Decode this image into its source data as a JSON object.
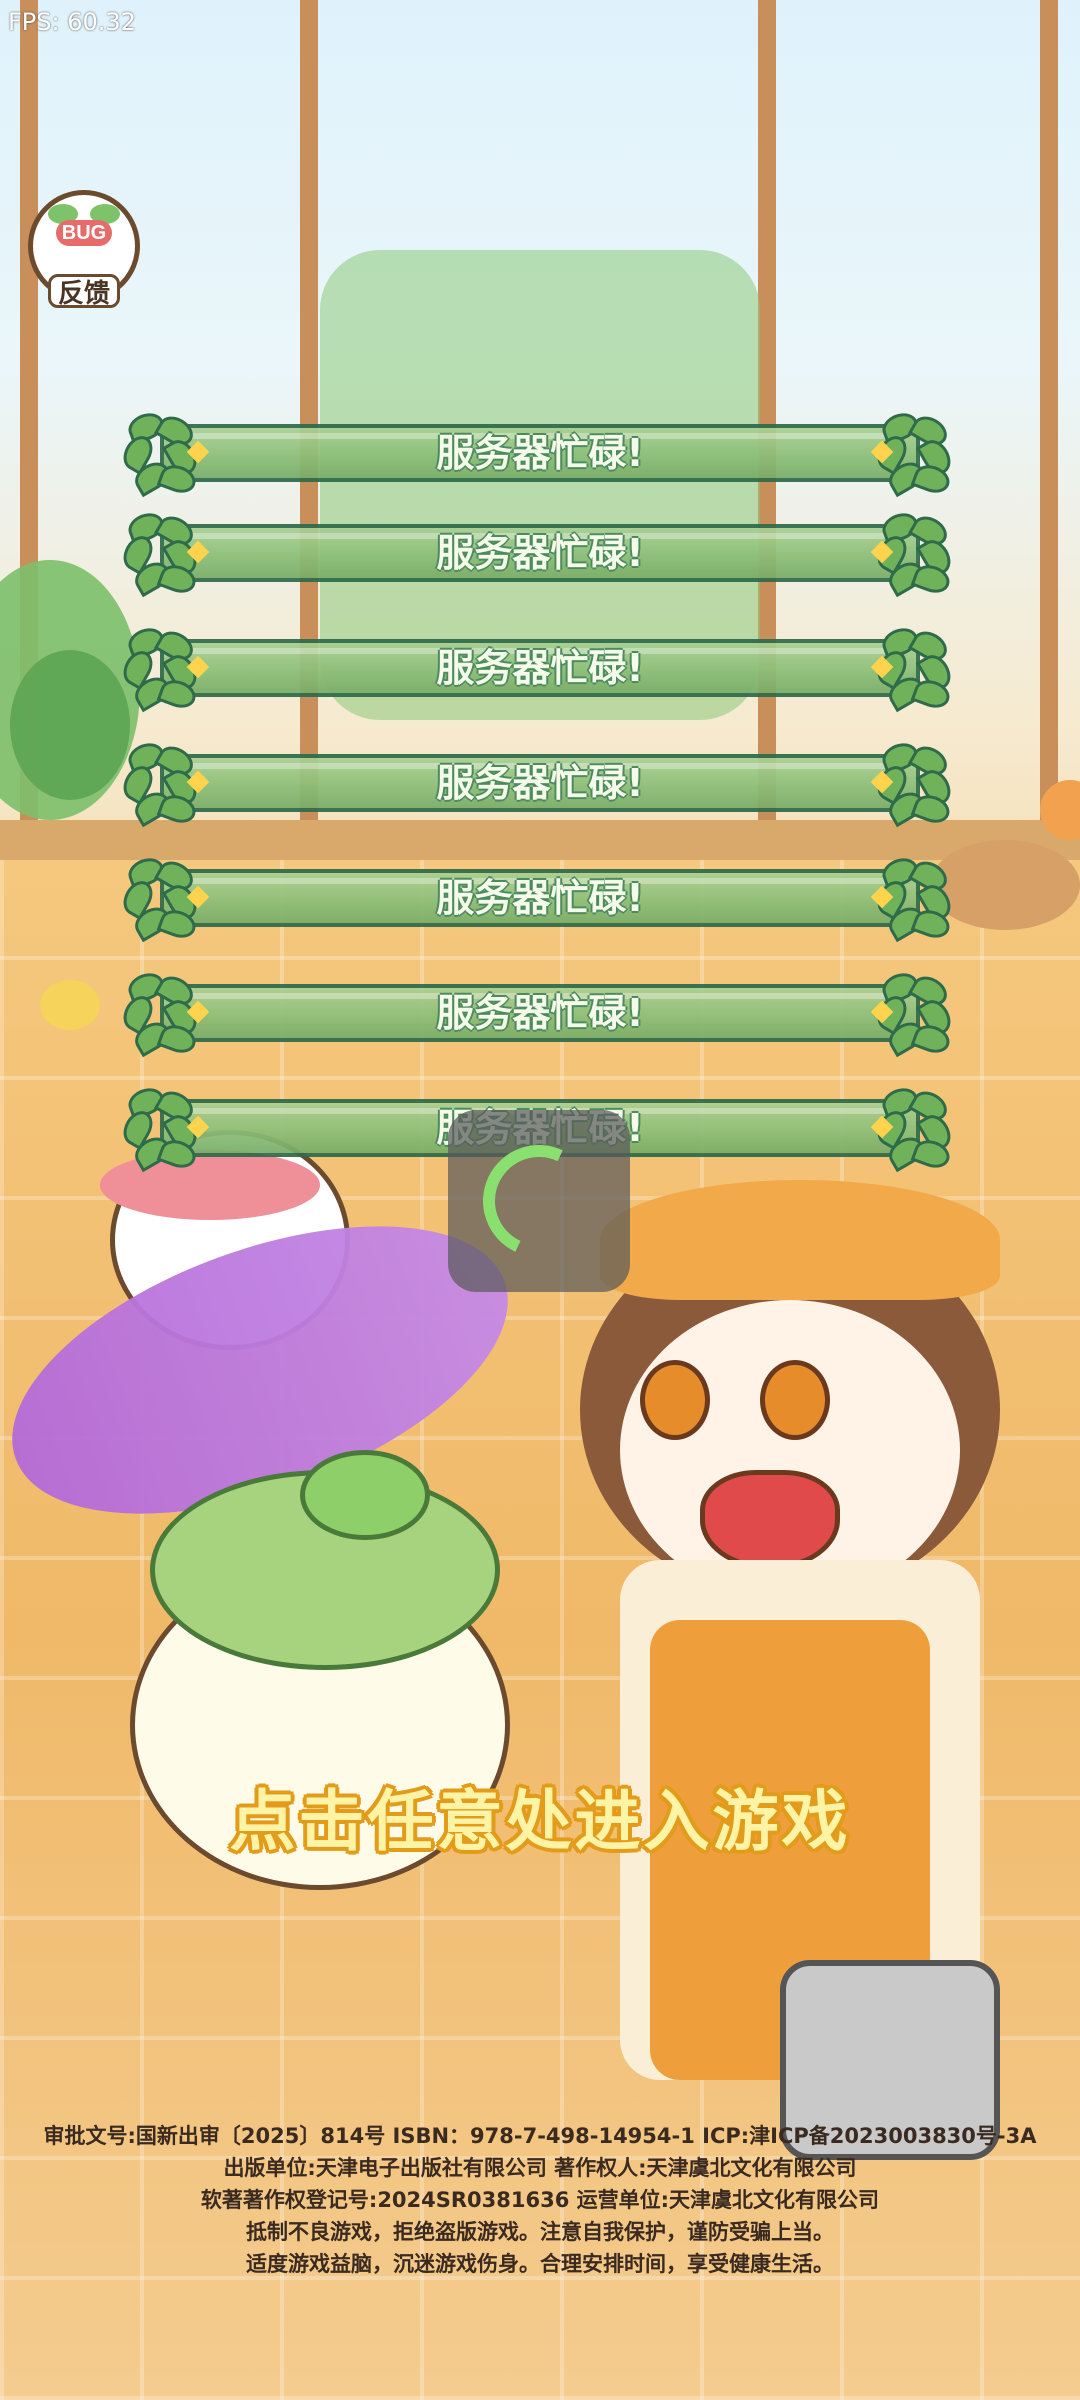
{
  "fps": "FPS: 60.32",
  "feedback": {
    "tag": "BUG",
    "label": "反馈"
  },
  "servers": [
    {
      "label": "服务器忙碌!"
    },
    {
      "label": "服务器忙碌!"
    },
    {
      "label": "服务器忙碌!"
    },
    {
      "label": "服务器忙碌!"
    },
    {
      "label": "服务器忙碌!"
    },
    {
      "label": "服务器忙碌!"
    },
    {
      "label": "服务器忙碌!"
    }
  ],
  "enter_prompt": "点击任意处进入游戏",
  "legal": {
    "line1": "审批文号:国新出审〔2025〕814号  ISBN：978-7-498-14954-1 ICP:津ICP备2023003830号-3A",
    "line2": "出版单位:天津电子出版社有限公司  著作权人:天津虞北文化有限公司",
    "line3": "软著著作权登记号:2024SR0381636 运营单位:天津虞北文化有限公司",
    "line4": "抵制不良游戏，拒绝盗版游戏。注意自我保护，谨防受骗上当。",
    "line5": "适度游戏益脑，沉迷游戏伤身。合理安排时间，享受健康生活。"
  },
  "colors": {
    "banner_green": "#8cbf78",
    "banner_border": "#2f6b4a",
    "spinner": "#8ae06f",
    "prompt_fill": "#fff3a6",
    "prompt_outline": "#e39b1a"
  }
}
